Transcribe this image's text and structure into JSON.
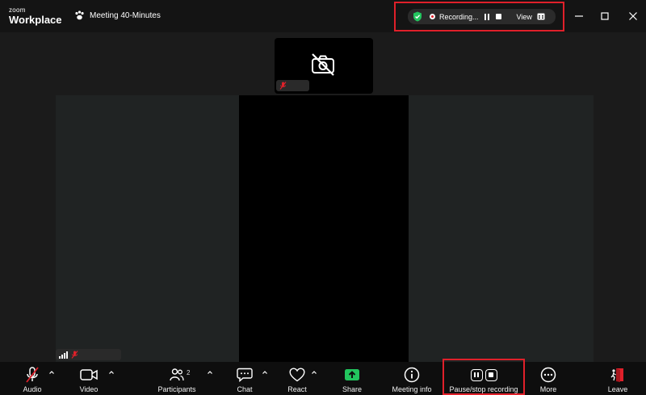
{
  "app": {
    "logo_line1": "zoom",
    "logo_line2": "Workplace"
  },
  "meeting": {
    "title": "Meeting 40-Minutes"
  },
  "recording_pill": {
    "status": "Recording...",
    "view_label": "View"
  },
  "participants_count": "2",
  "toolbar": {
    "audio": "Audio",
    "video": "Video",
    "participants": "Participants",
    "chat": "Chat",
    "react": "React",
    "share": "Share",
    "meeting_info": "Meeting info",
    "pause_stop": "Pause/stop recording",
    "more": "More",
    "leave": "Leave"
  },
  "colors": {
    "accent_red": "#e0202a",
    "share_green": "#22c55e",
    "shield_green": "#22c55e",
    "leave_red": "#e0202a"
  }
}
